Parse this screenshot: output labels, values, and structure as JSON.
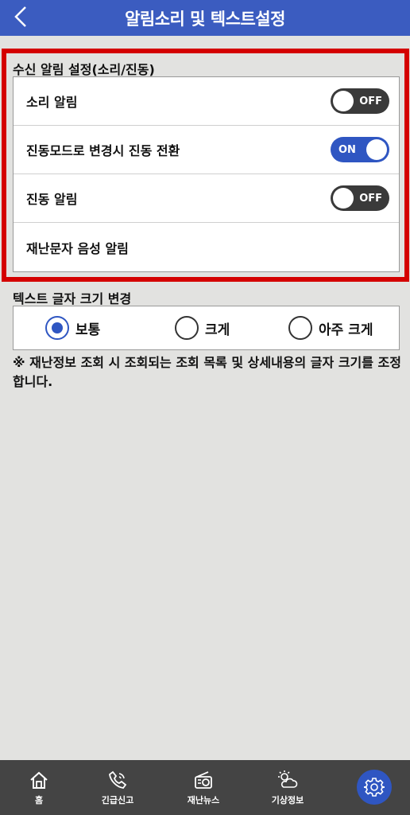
{
  "header": {
    "title": "알림소리 및 텍스트설정"
  },
  "alarm_section": {
    "title": "수신 알림 설정(소리/진동)",
    "rows": [
      {
        "label": "소리 알림",
        "toggle": "OFF"
      },
      {
        "label": "진동모드로 변경시 진동 전환",
        "toggle": "ON"
      },
      {
        "label": "진동 알림",
        "toggle": "OFF"
      },
      {
        "label": "재난문자 음성 알림"
      }
    ]
  },
  "text_section": {
    "title": "텍스트 글자 크기 변경",
    "options": [
      {
        "label": "보통",
        "selected": true
      },
      {
        "label": "크게",
        "selected": false
      },
      {
        "label": "아주 크게",
        "selected": false
      }
    ],
    "note": "※ 재난정보 조회 시 조회되는 조회 목록 및 상세내용의 글자 크기를 조정합니다."
  },
  "bottom_nav": {
    "items": [
      {
        "label": "홈",
        "icon": "home-icon"
      },
      {
        "label": "긴급신고",
        "icon": "phone-icon"
      },
      {
        "label": "재난뉴스",
        "icon": "radio-icon"
      },
      {
        "label": "기상정보",
        "icon": "weather-icon"
      },
      {
        "label": "",
        "icon": "gear-icon"
      }
    ]
  },
  "colors": {
    "header": "#3b5cc0",
    "accent": "#2f56c2",
    "highlight": "#d40000",
    "nav": "#444444"
  }
}
